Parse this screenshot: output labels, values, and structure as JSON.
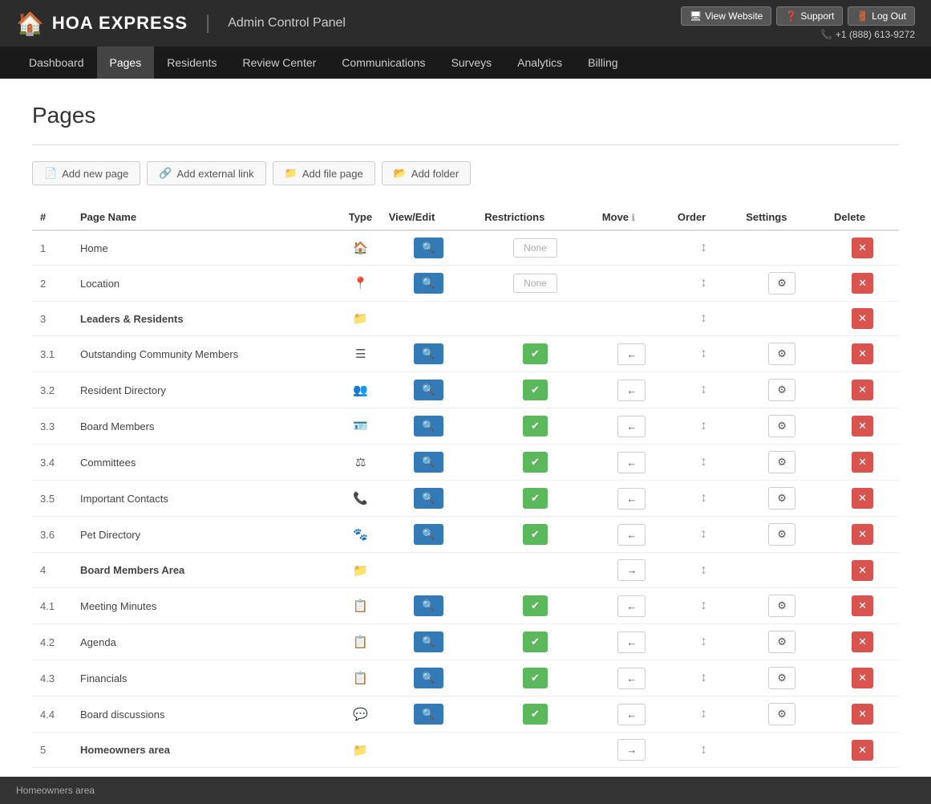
{
  "header": {
    "logo_text": "HOA EXPRESS",
    "admin_title": "Admin Control Panel",
    "buttons": [
      {
        "label": "View Website",
        "icon": "🖥"
      },
      {
        "label": "Support",
        "icon": "❓"
      },
      {
        "label": "Log Out",
        "icon": "🚪"
      }
    ],
    "phone": "+1 (888) 613-9272"
  },
  "nav": {
    "items": [
      {
        "label": "Dashboard",
        "active": false
      },
      {
        "label": "Pages",
        "active": true
      },
      {
        "label": "Residents",
        "active": false
      },
      {
        "label": "Review Center",
        "active": false
      },
      {
        "label": "Communications",
        "active": false
      },
      {
        "label": "Surveys",
        "active": false
      },
      {
        "label": "Analytics",
        "active": false
      },
      {
        "label": "Billing",
        "active": false
      }
    ]
  },
  "page": {
    "title": "Pages"
  },
  "actions": [
    {
      "label": "Add new page",
      "icon": "📄"
    },
    {
      "label": "Add external link",
      "icon": "🔗"
    },
    {
      "label": "Add file page",
      "icon": "📁"
    },
    {
      "label": "Add folder",
      "icon": "📂"
    }
  ],
  "table": {
    "columns": [
      "#",
      "Page Name",
      "Type",
      "View/Edit",
      "Restrictions",
      "Move",
      "Order",
      "Settings",
      "Delete"
    ],
    "rows": [
      {
        "num": "1",
        "name": "Home",
        "type": "home",
        "view": true,
        "restriction": "None",
        "move": null,
        "order": true,
        "settings": false,
        "delete": true,
        "bold": false,
        "folder": false,
        "move_right": false
      },
      {
        "num": "2",
        "name": "Location",
        "type": "pin",
        "view": true,
        "restriction": "None",
        "move": null,
        "order": true,
        "settings": true,
        "delete": true,
        "bold": false,
        "folder": false,
        "move_right": false
      },
      {
        "num": "3",
        "name": "Leaders & Residents",
        "type": "folder",
        "view": false,
        "restriction": null,
        "move": null,
        "order": true,
        "settings": false,
        "delete": true,
        "bold": true,
        "folder": true,
        "move_right": false
      },
      {
        "num": "3.1",
        "name": "Outstanding Community Members",
        "type": "list",
        "view": true,
        "restriction": "green",
        "move": "left",
        "order": true,
        "settings": true,
        "delete": true,
        "bold": false,
        "folder": false,
        "move_right": false
      },
      {
        "num": "3.2",
        "name": "Resident Directory",
        "type": "people",
        "view": true,
        "restriction": "green",
        "move": "left",
        "order": true,
        "settings": true,
        "delete": true,
        "bold": false,
        "folder": false,
        "move_right": false
      },
      {
        "num": "3.3",
        "name": "Board Members",
        "type": "id",
        "view": true,
        "restriction": "green",
        "move": "left",
        "order": true,
        "settings": true,
        "delete": true,
        "bold": false,
        "folder": false,
        "move_right": false
      },
      {
        "num": "3.4",
        "name": "Committees",
        "type": "scale",
        "view": true,
        "restriction": "green",
        "move": "left",
        "order": true,
        "settings": true,
        "delete": true,
        "bold": false,
        "folder": false,
        "move_right": false
      },
      {
        "num": "3.5",
        "name": "Important Contacts",
        "type": "phone",
        "view": true,
        "restriction": "green",
        "move": "left",
        "order": true,
        "settings": true,
        "delete": true,
        "bold": false,
        "folder": false,
        "move_right": false
      },
      {
        "num": "3.6",
        "name": "Pet Directory",
        "type": "paw",
        "view": true,
        "restriction": "green",
        "move": "left",
        "order": true,
        "settings": true,
        "delete": true,
        "bold": false,
        "folder": false,
        "move_right": false
      },
      {
        "num": "4",
        "name": "Board Members Area",
        "type": "folder",
        "view": false,
        "restriction": null,
        "move": "right",
        "order": true,
        "settings": false,
        "delete": true,
        "bold": true,
        "folder": true,
        "move_right": true
      },
      {
        "num": "4.1",
        "name": "Meeting Minutes",
        "type": "copy",
        "view": true,
        "restriction": "green",
        "move": "left",
        "order": true,
        "settings": true,
        "delete": true,
        "bold": false,
        "folder": false,
        "move_right": false
      },
      {
        "num": "4.2",
        "name": "Agenda",
        "type": "copy",
        "view": true,
        "restriction": "green",
        "move": "left",
        "order": true,
        "settings": true,
        "delete": true,
        "bold": false,
        "folder": false,
        "move_right": false
      },
      {
        "num": "4.3",
        "name": "Financials",
        "type": "copy",
        "view": true,
        "restriction": "green",
        "move": "left",
        "order": true,
        "settings": true,
        "delete": true,
        "bold": false,
        "folder": false,
        "move_right": false
      },
      {
        "num": "4.4",
        "name": "Board discussions",
        "type": "chat",
        "view": true,
        "restriction": "green",
        "move": "left",
        "order": true,
        "settings": true,
        "delete": true,
        "bold": false,
        "folder": false,
        "move_right": false
      },
      {
        "num": "5",
        "name": "Homeowners area",
        "type": "folder",
        "view": false,
        "restriction": null,
        "move": "right",
        "order": true,
        "settings": false,
        "delete": true,
        "bold": true,
        "folder": true,
        "move_right": true
      }
    ]
  },
  "footer": {
    "text": "Homeowners area"
  },
  "icons": {
    "home": "🏠",
    "pin": "📍",
    "folder": "📁",
    "list": "☰",
    "people": "👥",
    "id": "🪪",
    "scale": "⚖",
    "phone": "📞",
    "paw": "🐾",
    "copy": "📋",
    "chat": "💬"
  }
}
